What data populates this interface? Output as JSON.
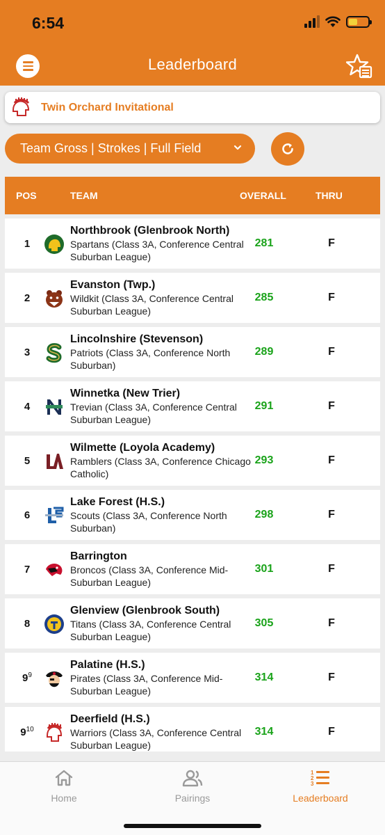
{
  "status": {
    "time": "6:54"
  },
  "header": {
    "title": "Leaderboard"
  },
  "tournament": {
    "name": "Twin Orchard Invitational"
  },
  "filter": {
    "label": "Team Gross | Strokes | Full Field"
  },
  "table": {
    "columns": {
      "pos": "POS",
      "team": "TEAM",
      "overall": "OVERALL",
      "thru": "THRU"
    },
    "rows": [
      {
        "pos": "1",
        "sup": "",
        "name": "Northbrook (Glenbrook North)",
        "sub": "Spartans (Class 3A, Conference Central Suburban League)",
        "overall": "281",
        "thru": "F",
        "logo": "spartan-logo-icon"
      },
      {
        "pos": "2",
        "sup": "",
        "name": "Evanston (Twp.)",
        "sub": "Wildkit (Class 3A, Conference Central Suburban League)",
        "overall": "285",
        "thru": "F",
        "logo": "wildkit-logo-icon"
      },
      {
        "pos": "3",
        "sup": "",
        "name": "Lincolnshire (Stevenson)",
        "sub": "Patriots (Class 3A, Conference North Suburban)",
        "overall": "289",
        "thru": "F",
        "logo": "s-logo-icon"
      },
      {
        "pos": "4",
        "sup": "",
        "name": "Winnetka (New Trier)",
        "sub": "Trevian (Class 3A, Conference Central Suburban League)",
        "overall": "291",
        "thru": "F",
        "logo": "nt-logo-icon"
      },
      {
        "pos": "5",
        "sup": "",
        "name": "Wilmette (Loyola Academy)",
        "sub": "Ramblers (Class 3A, Conference Chicago Catholic)",
        "overall": "293",
        "thru": "F",
        "logo": "la-logo-icon"
      },
      {
        "pos": "6",
        "sup": "",
        "name": "Lake Forest (H.S.)",
        "sub": "Scouts (Class 3A, Conference North Suburban)",
        "overall": "298",
        "thru": "F",
        "logo": "lf-logo-icon"
      },
      {
        "pos": "7",
        "sup": "",
        "name": "Barrington",
        "sub": "Broncos (Class 3A, Conference Mid-Suburban League)",
        "overall": "301",
        "thru": "F",
        "logo": "bronco-logo-icon"
      },
      {
        "pos": "8",
        "sup": "",
        "name": "Glenview (Glenbrook South)",
        "sub": "Titans (Class 3A, Conference Central Suburban League)",
        "overall": "305",
        "thru": "F",
        "logo": "titan-logo-icon"
      },
      {
        "pos": "9",
        "sup": "9",
        "name": "Palatine (H.S.)",
        "sub": "Pirates (Class 3A, Conference Mid-Suburban League)",
        "overall": "314",
        "thru": "F",
        "logo": "pirate-logo-icon"
      },
      {
        "pos": "9",
        "sup": "10",
        "name": "Deerfield (H.S.)",
        "sub": "Warriors (Class 3A, Conference Central Suburban League)",
        "overall": "314",
        "thru": "F",
        "logo": "warrior-logo-icon"
      }
    ]
  },
  "tabs": [
    {
      "label": "Home",
      "icon": "home-icon"
    },
    {
      "label": "Pairings",
      "icon": "people-icon"
    },
    {
      "label": "Leaderboard",
      "icon": "leaderboard-list-icon"
    }
  ],
  "colors": {
    "accent": "#e57d22",
    "score": "#1aa31a"
  }
}
